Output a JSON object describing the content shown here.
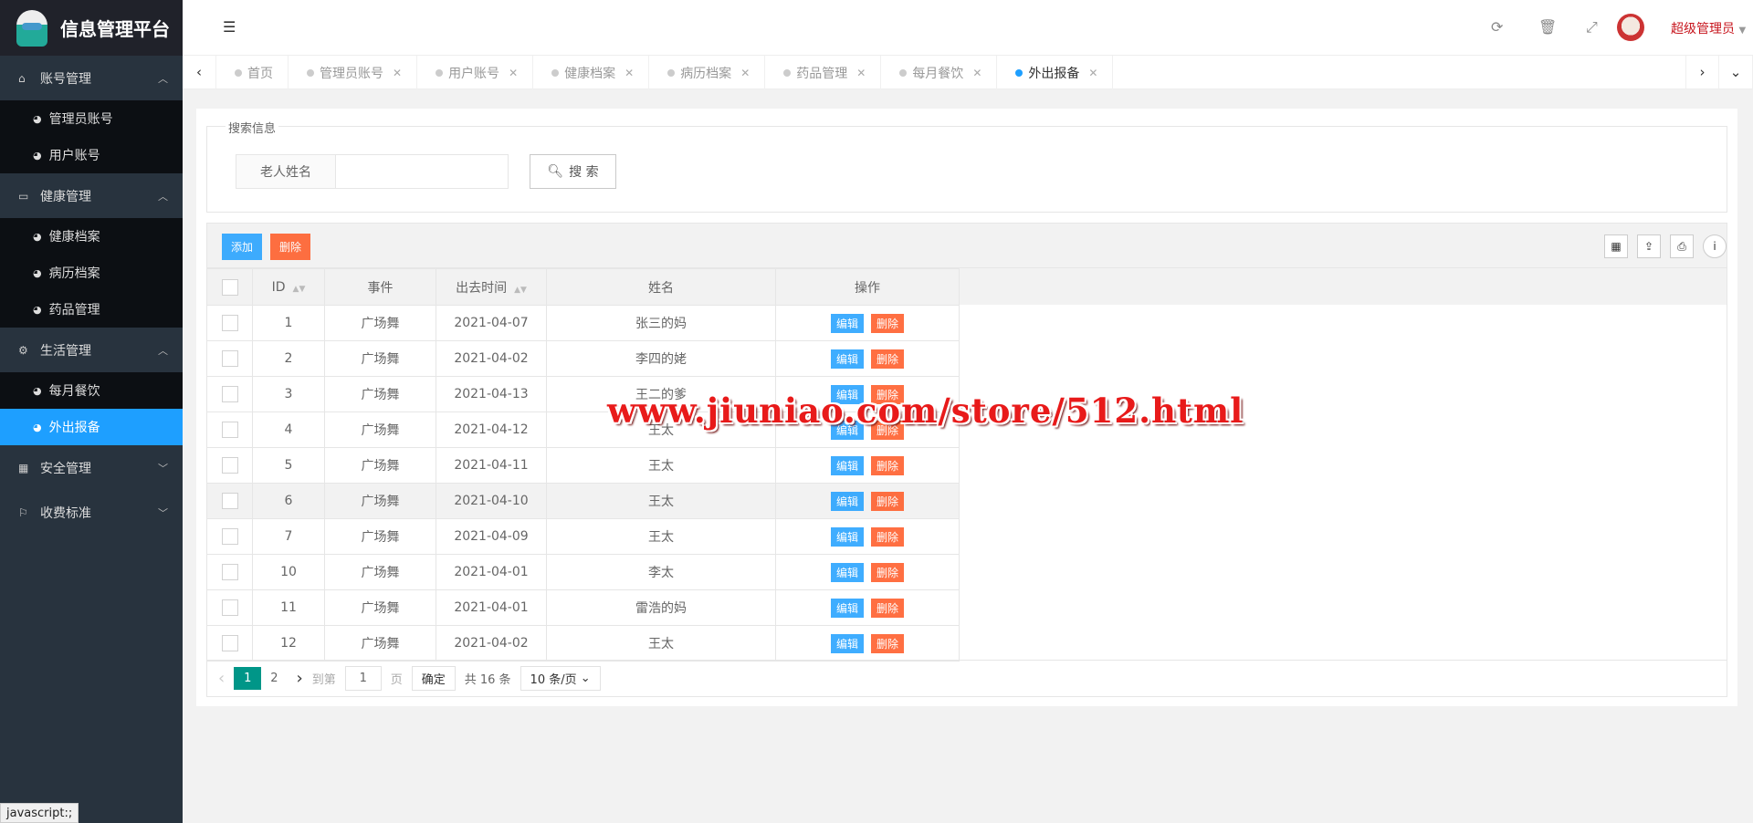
{
  "app": {
    "title": "信息管理平台"
  },
  "sidebar": {
    "groups": [
      {
        "label": "账号管理",
        "icon": "home-icon",
        "items": [
          "管理员账号",
          "用户账号"
        ]
      },
      {
        "label": "健康管理",
        "icon": "window-icon",
        "items": [
          "健康档案",
          "病历档案",
          "药品管理"
        ]
      },
      {
        "label": "生活管理",
        "icon": "gears-icon",
        "items": [
          "每月餐饮",
          "外出报备"
        ]
      },
      {
        "label": "安全管理",
        "icon": "calendar-icon",
        "items": []
      },
      {
        "label": "收费标准",
        "icon": "flag-icon",
        "items": []
      }
    ],
    "active": "外出报备"
  },
  "header": {
    "user": "超级管理员"
  },
  "tabs": [
    {
      "label": "首页"
    },
    {
      "label": "管理员账号"
    },
    {
      "label": "用户账号"
    },
    {
      "label": "健康档案"
    },
    {
      "label": "病历档案"
    },
    {
      "label": "药品管理"
    },
    {
      "label": "每月餐饮"
    },
    {
      "label": "外出报备"
    }
  ],
  "search": {
    "legend": "搜索信息",
    "label": "老人姓名",
    "value": "",
    "button": "搜 索"
  },
  "toolbar": {
    "add": "添加",
    "delete": "删除"
  },
  "table": {
    "columns": [
      "ID",
      "事件",
      "出去时间",
      "姓名",
      "操作"
    ],
    "edit": "编辑",
    "del": "删除",
    "rows": [
      [
        "1",
        "广场舞",
        "2021-04-07",
        "张三的妈"
      ],
      [
        "2",
        "广场舞",
        "2021-04-02",
        "李四的姥"
      ],
      [
        "3",
        "广场舞",
        "2021-04-13",
        "王二的爹"
      ],
      [
        "4",
        "广场舞",
        "2021-04-12",
        "王太"
      ],
      [
        "5",
        "广场舞",
        "2021-04-11",
        "王太"
      ],
      [
        "6",
        "广场舞",
        "2021-04-10",
        "王太"
      ],
      [
        "7",
        "广场舞",
        "2021-04-09",
        "王太"
      ],
      [
        "10",
        "广场舞",
        "2021-04-01",
        "李太"
      ],
      [
        "11",
        "广场舞",
        "2021-04-01",
        "雷浩的妈"
      ],
      [
        "12",
        "广场舞",
        "2021-04-02",
        "王太"
      ]
    ]
  },
  "pagination": {
    "current": "1",
    "next_page": "2",
    "goto": "到第",
    "page_input": "1",
    "page_unit": "页",
    "confirm": "确定",
    "total": "共 16 条",
    "per_page": "10 条/页"
  },
  "watermark": "www.jiuniao.com/store/512.html",
  "statusbar": "javascript:;"
}
